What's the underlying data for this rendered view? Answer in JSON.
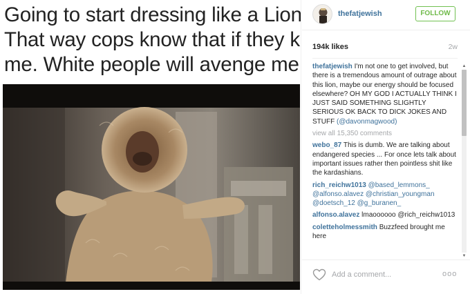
{
  "meme": {
    "caption_lines": [
      "Going to start dressing like a Lion.",
      "That way cops know that if they kill",
      "me. White people will avenge me"
    ]
  },
  "post": {
    "username": "thefatjewish",
    "follow_label": "FOLLOW",
    "likes": "194k likes",
    "time_ago": "2w",
    "follow_color": "#70c050",
    "username_color": "#3f729b"
  },
  "comments": [
    {
      "user": "thefatjewish",
      "text": "I'm not one to get involved, but there is a tremendous amount of outrage about this lion, maybe our energy should be focused elsewhere? OH MY GOD I ACTUALLY THINK I JUST SAID SOMETHING SLIGHTLY SERIOUS OK BACK TO DICK JOKES AND STUFF",
      "mention": "(@davonmagwood)"
    },
    {
      "user": "webo_87",
      "text": "This is dumb. We are talking about endangered species ... For once lets talk about important issues rather then pointless shit like the kardashians."
    },
    {
      "user": "rich_reichw1013",
      "text": "@based_lemmons_ @alfonso.alavez @christian_youngman @doetsch_12 @g_buranen_"
    },
    {
      "user": "alfonso.alavez",
      "text": "lmaoooooo @rich_reichw1013"
    },
    {
      "user": "coletteholmessmith",
      "text": "Buzzfeed brought me here"
    }
  ],
  "view_all_label": "view all 15,350 comments",
  "footer": {
    "add_comment_placeholder": "Add a comment...",
    "more_label": "ooo",
    "icons": [
      "heart-icon",
      "more-options-icon"
    ]
  }
}
